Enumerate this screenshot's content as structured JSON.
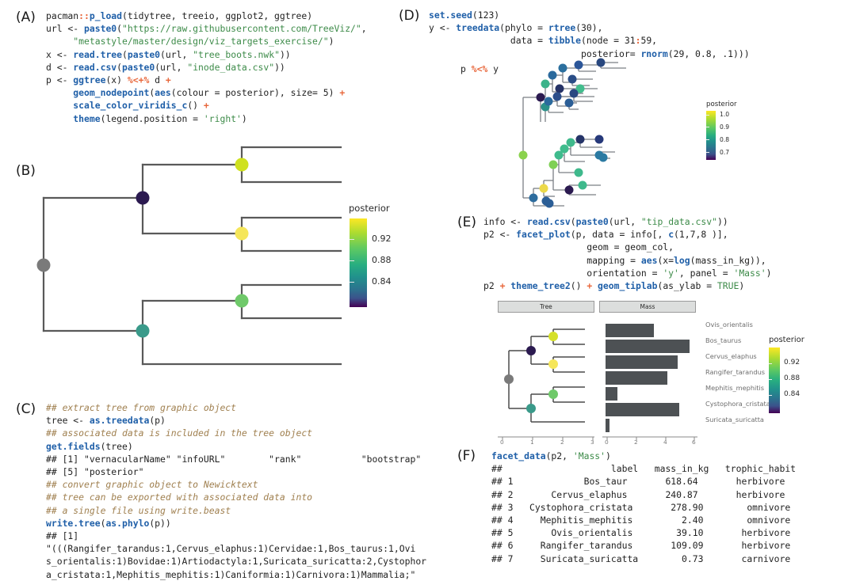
{
  "panels": {
    "A": {
      "label": "(A)",
      "lines": [
        [
          {
            "t": "pacman",
            "c": "plain"
          },
          {
            "t": "::",
            "c": "op"
          },
          {
            "t": "p_load",
            "c": "fn"
          },
          {
            "t": "(tidytree, treeio, ggplot2, ggtree)",
            "c": "plain"
          }
        ],
        [
          {
            "t": "url <- ",
            "c": "plain"
          },
          {
            "t": "paste0",
            "c": "fn"
          },
          {
            "t": "(",
            "c": "plain"
          },
          {
            "t": "\"https://raw.githubusercontent.com/TreeViz/\"",
            "c": "str"
          },
          {
            "t": ",",
            "c": "plain"
          }
        ],
        [
          {
            "t": "     ",
            "c": "plain"
          },
          {
            "t": "\"metastyle/master/design/viz_targets_exercise/\"",
            "c": "str"
          },
          {
            "t": ")",
            "c": "plain"
          }
        ],
        [
          {
            "t": "x <- ",
            "c": "plain"
          },
          {
            "t": "read.tree",
            "c": "fn"
          },
          {
            "t": "(",
            "c": "plain"
          },
          {
            "t": "paste0",
            "c": "fn"
          },
          {
            "t": "(url, ",
            "c": "plain"
          },
          {
            "t": "\"tree_boots.nwk\"",
            "c": "str"
          },
          {
            "t": "))",
            "c": "plain"
          }
        ],
        [
          {
            "t": "d <- ",
            "c": "plain"
          },
          {
            "t": "read.csv",
            "c": "fn"
          },
          {
            "t": "(",
            "c": "plain"
          },
          {
            "t": "paste0",
            "c": "fn"
          },
          {
            "t": "(url, ",
            "c": "plain"
          },
          {
            "t": "\"inode_data.csv\"",
            "c": "str"
          },
          {
            "t": "))",
            "c": "plain"
          }
        ],
        [
          {
            "t": "p <- ",
            "c": "plain"
          },
          {
            "t": "ggtree",
            "c": "fn"
          },
          {
            "t": "(x) ",
            "c": "plain"
          },
          {
            "t": "%<+%",
            "c": "op"
          },
          {
            "t": " d ",
            "c": "plain"
          },
          {
            "t": "+",
            "c": "op"
          }
        ],
        [
          {
            "t": "     ",
            "c": "plain"
          },
          {
            "t": "geom_nodepoint",
            "c": "fn"
          },
          {
            "t": "(",
            "c": "plain"
          },
          {
            "t": "aes",
            "c": "fn"
          },
          {
            "t": "(colour = posterior), size= 5) ",
            "c": "plain"
          },
          {
            "t": "+",
            "c": "op"
          }
        ],
        [
          {
            "t": "     ",
            "c": "plain"
          },
          {
            "t": "scale_color_viridis_c",
            "c": "fn"
          },
          {
            "t": "() ",
            "c": "plain"
          },
          {
            "t": "+",
            "c": "op"
          }
        ],
        [
          {
            "t": "     ",
            "c": "plain"
          },
          {
            "t": "theme",
            "c": "fn"
          },
          {
            "t": "(legend.position = ",
            "c": "plain"
          },
          {
            "t": "'right'",
            "c": "str"
          },
          {
            "t": ")",
            "c": "plain"
          }
        ]
      ]
    },
    "B": {
      "label": "(B)"
    },
    "C": {
      "label": "(C)",
      "lines": [
        [
          {
            "t": "## extract tree from graphic object",
            "c": "cmt"
          }
        ],
        [
          {
            "t": "tree <- ",
            "c": "plain"
          },
          {
            "t": "as.treedata",
            "c": "fn"
          },
          {
            "t": "(p)",
            "c": "plain"
          }
        ],
        [
          {
            "t": "## associated data is included in the tree object",
            "c": "cmt"
          }
        ],
        [
          {
            "t": "get.fields",
            "c": "fn"
          },
          {
            "t": "(tree)",
            "c": "plain"
          }
        ],
        [
          {
            "t": "## [1] \"vernacularName\" \"infoURL\"        \"rank\"           \"bootstrap\"",
            "c": "plain"
          }
        ],
        [
          {
            "t": "## [5] \"posterior\"",
            "c": "plain"
          }
        ],
        [
          {
            "t": "## convert graphic object to Newicktext",
            "c": "cmt"
          }
        ],
        [
          {
            "t": "## tree can be exported with associated data into",
            "c": "cmt"
          }
        ],
        [
          {
            "t": "## a single file using write.beast",
            "c": "cmt"
          }
        ],
        [
          {
            "t": "write.tree",
            "c": "fn"
          },
          {
            "t": "(",
            "c": "plain"
          },
          {
            "t": "as.phylo",
            "c": "fn"
          },
          {
            "t": "(p))",
            "c": "plain"
          }
        ],
        [
          {
            "t": "## [1]",
            "c": "plain"
          }
        ],
        [
          {
            "t": "\"(((Rangifer_tarandus:1,Cervus_elaphus:1)Cervidae:1,Bos_taurus:1,Ovi",
            "c": "plain"
          }
        ],
        [
          {
            "t": "s_orientalis:1)Bovidae:1)Artiodactyla:1,Suricata_suricatta:2,Cystophor",
            "c": "plain"
          }
        ],
        [
          {
            "t": "a_cristata:1,Mephitis_mephitis:1)Caniformia:1)Carnivora:1)Mammalia;\"",
            "c": "plain"
          }
        ]
      ]
    },
    "D": {
      "label": "(D)",
      "lines": [
        [
          {
            "t": "set.seed",
            "c": "fn"
          },
          {
            "t": "(123)",
            "c": "plain"
          }
        ],
        [
          {
            "t": "y <- ",
            "c": "plain"
          },
          {
            "t": "treedata",
            "c": "fn"
          },
          {
            "t": "(phylo = ",
            "c": "plain"
          },
          {
            "t": "rtree",
            "c": "fn"
          },
          {
            "t": "(30),",
            "c": "plain"
          }
        ],
        [
          {
            "t": "               data = ",
            "c": "plain"
          },
          {
            "t": "tibble",
            "c": "fn"
          },
          {
            "t": "(node = 31",
            "c": "plain"
          },
          {
            "t": ":",
            "c": "op"
          },
          {
            "t": "59,",
            "c": "plain"
          }
        ],
        [
          {
            "t": "                            posterior= ",
            "c": "plain"
          },
          {
            "t": "rnorm",
            "c": "fn"
          },
          {
            "t": "(29, 0.8, .1)))",
            "c": "plain"
          }
        ]
      ],
      "pipe": [
        {
          "t": "p ",
          "c": "plain"
        },
        {
          "t": "%<%",
          "c": "op"
        },
        {
          "t": " y",
          "c": "plain"
        }
      ]
    },
    "E": {
      "label": "(E)",
      "lines": [
        [
          {
            "t": "info <- ",
            "c": "plain"
          },
          {
            "t": "read.csv",
            "c": "fn"
          },
          {
            "t": "(",
            "c": "plain"
          },
          {
            "t": "paste0",
            "c": "fn"
          },
          {
            "t": "(url, ",
            "c": "plain"
          },
          {
            "t": "\"tip_data.csv\"",
            "c": "str"
          },
          {
            "t": "))",
            "c": "plain"
          }
        ],
        [
          {
            "t": "p2 <- ",
            "c": "plain"
          },
          {
            "t": "facet_plot",
            "c": "fn"
          },
          {
            "t": "(p, data = info[, ",
            "c": "plain"
          },
          {
            "t": "c",
            "c": "fn"
          },
          {
            "t": "(1,7,8 )],",
            "c": "plain"
          }
        ],
        [
          {
            "t": "                   geom = geom_col,",
            "c": "plain"
          }
        ],
        [
          {
            "t": "                   mapping = ",
            "c": "plain"
          },
          {
            "t": "aes",
            "c": "fn"
          },
          {
            "t": "(x=",
            "c": "plain"
          },
          {
            "t": "log",
            "c": "fn"
          },
          {
            "t": "(mass_in_kg)),",
            "c": "plain"
          }
        ],
        [
          {
            "t": "                   orientation = ",
            "c": "plain"
          },
          {
            "t": "'y'",
            "c": "str"
          },
          {
            "t": ", panel = ",
            "c": "plain"
          },
          {
            "t": "'Mass'",
            "c": "str"
          },
          {
            "t": ")",
            "c": "plain"
          }
        ],
        [
          {
            "t": "p2 ",
            "c": "plain"
          },
          {
            "t": "+",
            "c": "op"
          },
          {
            "t": " ",
            "c": "plain"
          },
          {
            "t": "theme_tree2",
            "c": "fn"
          },
          {
            "t": "() ",
            "c": "plain"
          },
          {
            "t": "+",
            "c": "op"
          },
          {
            "t": " ",
            "c": "plain"
          },
          {
            "t": "geom_tiplab",
            "c": "fn"
          },
          {
            "t": "(as_ylab = ",
            "c": "plain"
          },
          {
            "t": "TRUE",
            "c": "str"
          },
          {
            "t": ")",
            "c": "plain"
          }
        ]
      ]
    },
    "F": {
      "label": "(F)",
      "call": [
        {
          "t": "facet_data",
          "c": "fn"
        },
        {
          "t": "(p2, ",
          "c": "plain"
        },
        {
          "t": "'Mass'",
          "c": "str"
        },
        {
          "t": ")",
          "c": "plain"
        }
      ],
      "header": "##                    label   mass_in_kg   trophic_habit",
      "rows": [
        "## 1             Bos_taur       618.64       herbivore",
        "## 2       Cervus_elaphus       240.87       herbivore",
        "## 3   Cystophora_cristata       278.90        omnivore",
        "## 4     Mephitis_mephitis         2.40        omnivore",
        "## 5       Ovis_orientalis        39.10       herbivore",
        "## 6     Rangifer_tarandus       109.09       herbivore",
        "## 7     Suricata_suricatta        0.73       carnivore"
      ]
    }
  },
  "legends": {
    "B": {
      "title": "posterior",
      "ticks": [
        "0.92",
        "0.88",
        "0.84"
      ]
    },
    "D": {
      "title": "posterior",
      "ticks": [
        "1.0",
        "0.9",
        "0.8",
        "0.7"
      ]
    },
    "E": {
      "title": "posterior",
      "ticks": [
        "0.92",
        "0.88",
        "0.84"
      ]
    }
  },
  "chart_data": [
    {
      "type": "tree",
      "name": "panel-b-phylogeny",
      "title": "",
      "legend_title": "posterior",
      "legend_ticks": [
        0.92,
        0.88,
        0.84
      ],
      "node_colors": [
        "#7a7a7a",
        "#2b1a50",
        "#cfe11f",
        "#f5e65a",
        "#6fc96a",
        "#3a9a8a"
      ],
      "nodes": [
        {
          "id": "root",
          "posterior": null,
          "color": "#7a7a7a"
        },
        {
          "id": "n1",
          "posterior": 0.83,
          "color": "#2b1a50"
        },
        {
          "id": "n2",
          "posterior": 0.95,
          "color": "#cfe11f"
        },
        {
          "id": "n3",
          "posterior": 0.97,
          "color": "#f5e65a"
        },
        {
          "id": "n4",
          "posterior": 0.93,
          "color": "#6fc96a"
        },
        {
          "id": "n5",
          "posterior": 0.885,
          "color": "#3a9a8a"
        }
      ]
    },
    {
      "type": "tree",
      "name": "panel-d-random-tree",
      "legend_title": "posterior",
      "legend_ticks": [
        1.0,
        0.9,
        0.8,
        0.7
      ],
      "n_tips": 30,
      "n_internal_nodes": 29
    },
    {
      "type": "bar",
      "name": "panel-e-mass-facet",
      "title": "Mass",
      "categories": [
        "Ovis_orientalis",
        "Bos_taurus",
        "Cervus_elaphus",
        "Rangifer_tarandus",
        "Mephitis_mephitis",
        "Cystophora_cristata",
        "Suricata_suricatta"
      ],
      "values": [
        3.67,
        6.43,
        5.48,
        4.69,
        0.88,
        5.63,
        -0.31
      ],
      "value_source": "log(mass_in_kg)",
      "xlabel": "",
      "ylabel": "",
      "xlim": [
        0,
        7
      ],
      "xticks_mass": [
        0,
        2,
        4,
        6
      ],
      "xticks_tree": [
        0,
        1,
        2,
        3
      ],
      "bar_color": "#4d5154",
      "facet_strips": [
        "Tree",
        "Mass"
      ]
    },
    {
      "type": "table",
      "name": "panel-f-facet-data",
      "columns": [
        "",
        "label",
        "mass_in_kg",
        "trophic_habit"
      ],
      "rows": [
        [
          "1",
          "Bos_taur",
          "618.64",
          "herbivore"
        ],
        [
          "2",
          "Cervus_elaphus",
          "240.87",
          "herbivore"
        ],
        [
          "3",
          "Cystophora_cristata",
          "278.90",
          "omnivore"
        ],
        [
          "4",
          "Mephitis_mephitis",
          "2.40",
          "omnivore"
        ],
        [
          "5",
          "Ovis_orientalis",
          "39.10",
          "herbivore"
        ],
        [
          "6",
          "Rangifer_tarandus",
          "109.09",
          "herbivore"
        ],
        [
          "7",
          "Suricata_suricatta",
          "0.73",
          "carnivore"
        ]
      ]
    }
  ],
  "tips": {
    "E": [
      "Ovis_orientalis",
      "Bos_taurus",
      "Cervus_elaphus",
      "Rangifer_tarandus",
      "Mephitis_mephitis",
      "Cystophora_cristata",
      "Suricata_suricatta"
    ]
  },
  "axis": {
    "E_tree_ticks": [
      "0",
      "1",
      "2",
      "3"
    ],
    "E_mass_ticks": [
      "0",
      "2",
      "4",
      "6"
    ]
  },
  "colors": {
    "viridis_top": "#fde725",
    "viridis_bottom": "#440154",
    "branch": "#595959",
    "bar": "#4d5154"
  }
}
